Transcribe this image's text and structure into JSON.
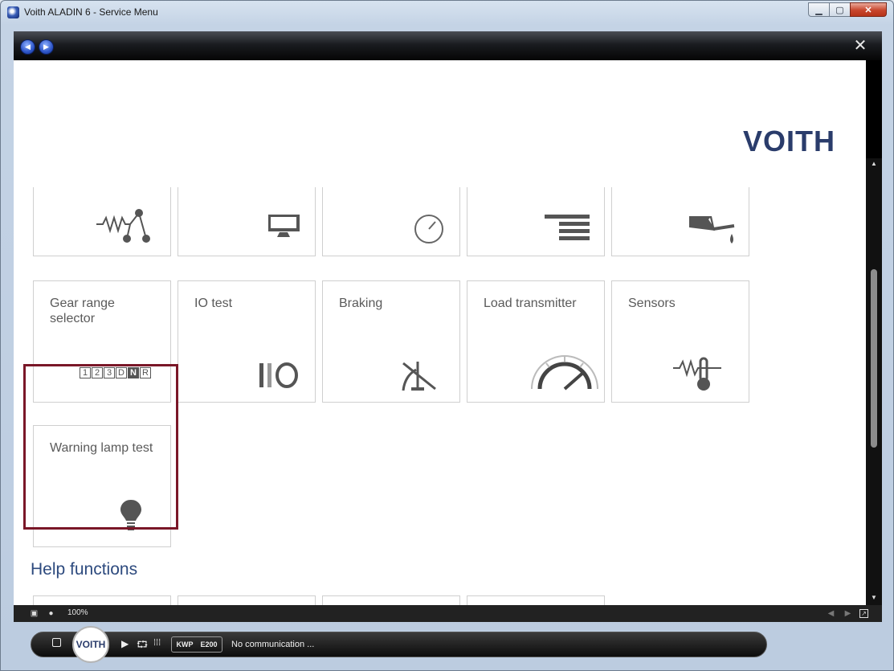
{
  "window": {
    "title": "Voith ALADIN 6 - Service Menu",
    "min_glyph": "▁",
    "max_glyph": "▢",
    "close_glyph": "✕"
  },
  "toolbar": {
    "back_glyph": "◀",
    "forward_glyph": "▶",
    "close_glyph": "✕"
  },
  "brand": {
    "logo_text": "VOITH",
    "color": "#2a3c6b"
  },
  "tiles_partial": [
    {
      "icon": "resistor-switch-icon"
    },
    {
      "icon": "monitor-icon"
    },
    {
      "icon": "dial-gauge-icon"
    },
    {
      "icon": "menu-lines-icon"
    },
    {
      "icon": "oil-can-icon"
    }
  ],
  "tiles": [
    {
      "label": "Gear range selector",
      "icon": "gear-range-icon",
      "gears": [
        "1",
        "2",
        "3",
        "D",
        "N",
        "R"
      ],
      "active_gear": "N"
    },
    {
      "label": "IO test",
      "icon": "io-test-icon"
    },
    {
      "label": "Braking",
      "icon": "braking-lever-icon"
    },
    {
      "label": "Load transmitter",
      "icon": "load-gauge-icon"
    },
    {
      "label": "Sensors",
      "icon": "thermometer-sensor-icon"
    }
  ],
  "highlighted_tile": {
    "label": "Warning lamp test",
    "icon": "lightbulb-icon",
    "highlight_color": "#7a1728"
  },
  "help_section": {
    "title": "Help functions"
  },
  "statusbar": {
    "zoom": "100%"
  },
  "bottom_bar": {
    "logo_text": "VOITH",
    "protocol": "KWP",
    "device": "E200",
    "status": "No communication ..."
  }
}
